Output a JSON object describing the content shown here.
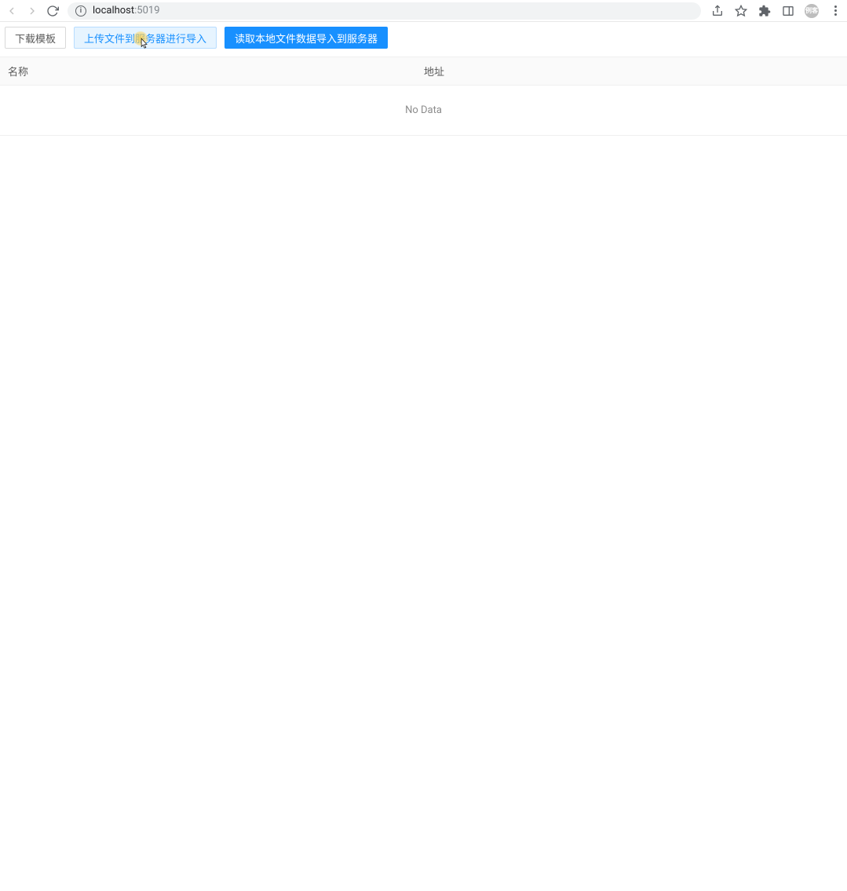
{
  "browser": {
    "url_host": "localhost",
    "url_port": ":5019",
    "avatar_text": "例客"
  },
  "toolbar": {
    "download_template": "下载模板",
    "upload_import": "上传文件到服务器进行导入",
    "read_local_import": "读取本地文件数据导入到服务器"
  },
  "table": {
    "columns": {
      "name": "名称",
      "address": "地址"
    },
    "empty_text": "No Data"
  }
}
